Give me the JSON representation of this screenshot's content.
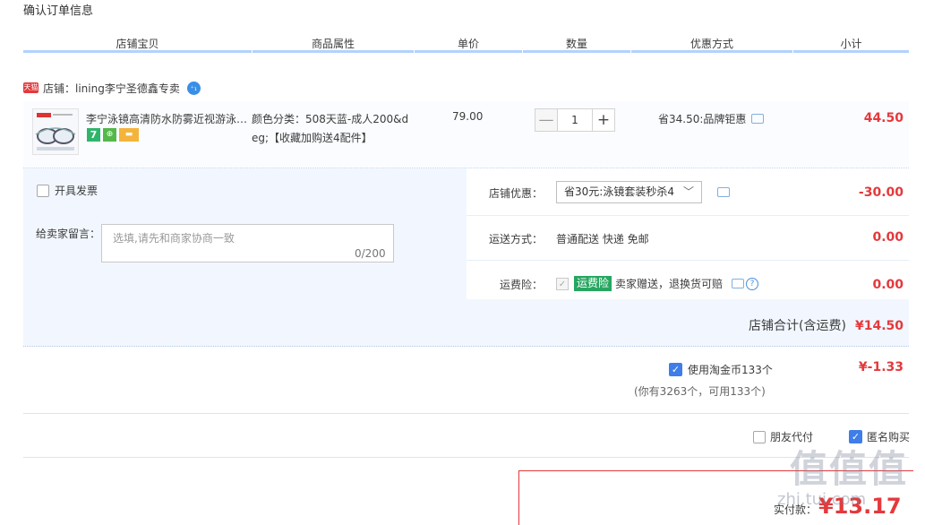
{
  "page_title": "确认订单信息",
  "columns": [
    "店铺宝贝",
    "商品属性",
    "单价",
    "数量",
    "优惠方式",
    "小计"
  ],
  "shop": {
    "badge": "天猫",
    "name": "店铺：lining李宁圣德鑫专卖",
    "ww": "⁺₁"
  },
  "item": {
    "title": "李宁泳镜高清防水防雾近视游泳…",
    "badges": [
      "7",
      "⊕",
      "▬"
    ],
    "attrs_line1": "颜色分类：508天蓝-成人200&d",
    "attrs_line2": "eg;【收藏加购送4配件】",
    "price": "79.00",
    "qty_minus": "—",
    "qty": "1",
    "qty_plus": "+",
    "promo": "省34.50:品牌钜惠",
    "subtotal": "44.50"
  },
  "invoice": {
    "label": "开具发票"
  },
  "message": {
    "label": "给卖家留言：",
    "placeholder": "选填,请先和商家协商一致",
    "counter": "0/200"
  },
  "shop_discount": {
    "label": "店铺优惠：",
    "selected": "省30元:泳镜套装秒杀4",
    "caret": "﹀",
    "amount": "-30.00"
  },
  "shipping": {
    "label": "运送方式：",
    "value": "普通配送 快递 免邮",
    "amount": "0.00"
  },
  "insurance": {
    "label": "运费险：",
    "check": "✓",
    "badge": "运费险",
    "text": "卖家赠送，退换货可赔",
    "help": "?",
    "amount": "0.00"
  },
  "shop_total": {
    "label": "店铺合计(含运费)",
    "amount": "¥14.50"
  },
  "coins": {
    "check": "✓",
    "label": "使用淘金币133个",
    "sub": "(你有3263个，可用133个)",
    "amount": "¥-1.33"
  },
  "friend_pay": {
    "label": "朋友代付"
  },
  "anonymous": {
    "check": "✓",
    "label": "匿名购买"
  },
  "pay": {
    "label": "实付款：",
    "amount": "¥13.17"
  },
  "watermark": {
    "main": "值值值",
    "url": "zhi.tui.com"
  }
}
